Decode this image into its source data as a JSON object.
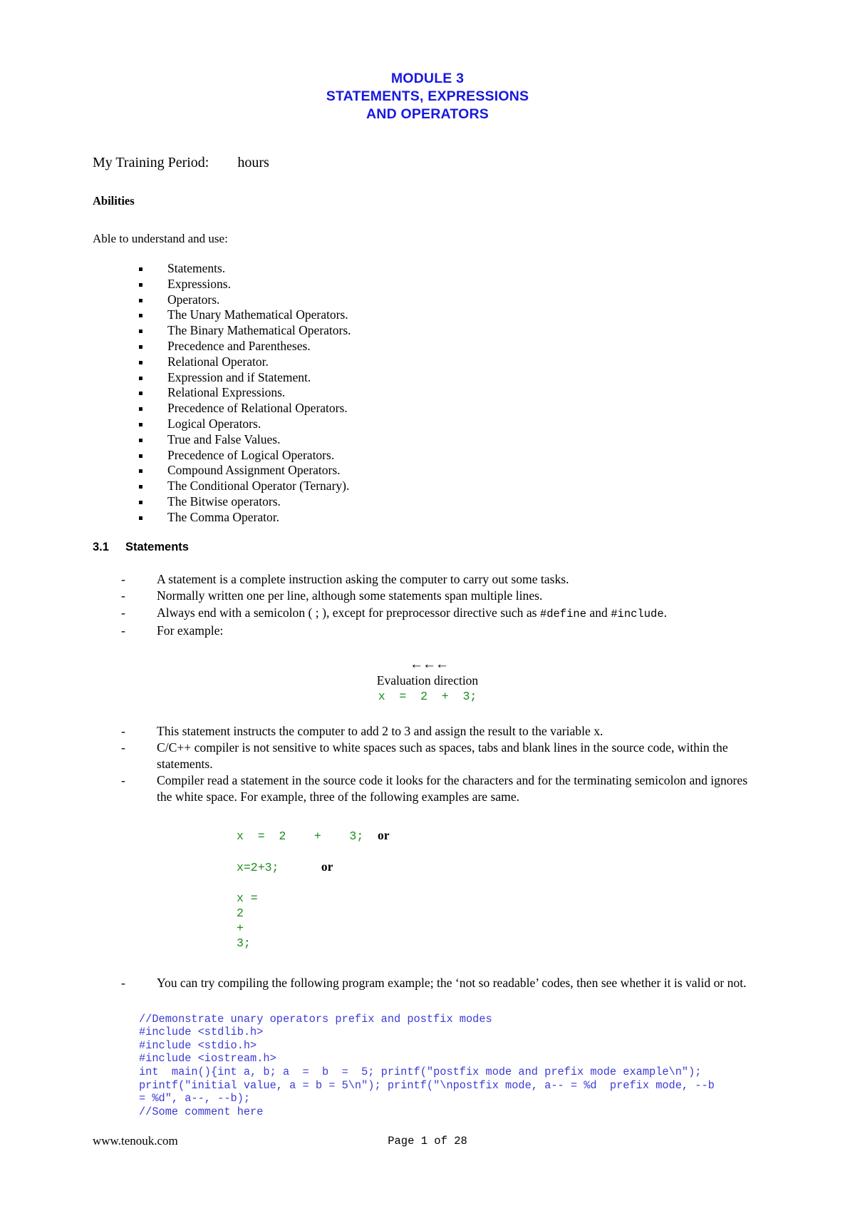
{
  "title": {
    "line1": "MODULE 3",
    "line2": "STATEMENTS, EXPRESSIONS",
    "line3": "AND OPERATORS",
    "color": "#1818e0"
  },
  "training": {
    "label": "My Training Period:",
    "value": "hours",
    "full": "My Training Period:        hours"
  },
  "abilities": {
    "heading": "Abilities",
    "intro": "Able to understand and use:",
    "items": [
      "Statements.",
      "Expressions.",
      "Operators.",
      "The Unary Mathematical Operators.",
      "The Binary Mathematical Operators.",
      "Precedence and Parentheses.",
      "Relational Operator.",
      "Expression and if Statement.",
      "Relational Expressions.",
      "Precedence of Relational Operators.",
      "Logical Operators.",
      "True and False Values.",
      "Precedence of Logical Operators.",
      "Compound Assignment Operators.",
      "The Conditional Operator (Ternary).",
      "The Bitwise operators.",
      "The Comma Operator."
    ]
  },
  "section": {
    "number": "3.1",
    "heading": "Statements",
    "points_a": [
      {
        "text": "A statement is a complete instruction asking the computer to carry out some tasks."
      },
      {
        "text": "Normally written one per line, although some statements span multiple lines."
      },
      {
        "pre": "Always end with a semicolon ( ; ), except for preprocessor directive such as ",
        "mono1": "#define",
        "mid": " and ",
        "mono2": "#include",
        "post": "."
      },
      {
        "text": "For example:"
      }
    ],
    "points_b": [
      {
        "text": "This statement instructs the computer to add 2 to 3 and assign the result to the variable x."
      },
      {
        "text": "C/C++ compiler is not sensitive to white spaces such as spaces, tabs and blank lines in the source code, within the statements."
      },
      {
        "text": "Compiler read a statement in the source code it looks for the characters and for the terminating semicolon and ignores the white space.  For example, three of the following examples are same."
      }
    ],
    "points_c": [
      {
        "text": "You can try compiling the following program example; the ‘not so readable’ codes, then see whether it is valid or not."
      }
    ]
  },
  "evaluation": {
    "arrows": "←←←",
    "label": "Evaluation direction",
    "code": "x  =  2  +  3;",
    "code_color": "#1c8c1c"
  },
  "code_samples": {
    "sample1_code": "x  =  2    +    3;  ",
    "sample1_or": "or",
    "sample2_code": "x=2+3;      ",
    "sample2_or": "or",
    "sample3": "x =\n2\n+\n3;"
  },
  "program_listing": {
    "color": "#3b3bd6",
    "lines": [
      "//Demonstrate unary operators prefix and postfix modes",
      "#include <stdlib.h>",
      "#include <stdio.h>",
      "#include <iostream.h>",
      "int  main(){int a, b; a  =  b  =  5; printf(\"postfix mode and prefix mode example\\n\");",
      "printf(\"initial value, a = b = 5\\n\"); printf(\"\\npostfix mode, a-- = %d  prefix mode, --b",
      "= %d\", a--, --b);",
      "//Some comment here"
    ]
  },
  "footer": {
    "site": "www.tenouk.com",
    "page": "Page 1 of 28"
  }
}
